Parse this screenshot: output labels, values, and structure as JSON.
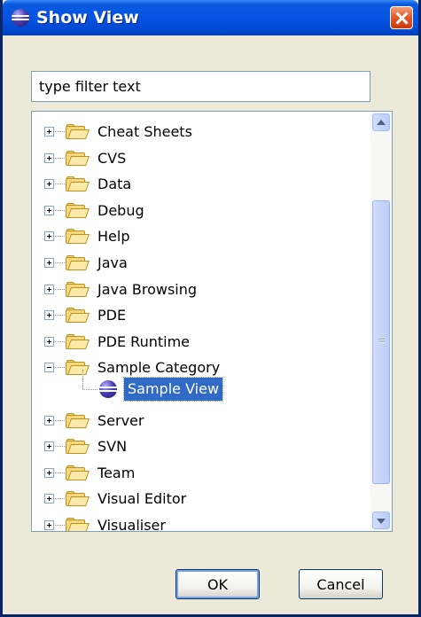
{
  "window": {
    "title": "Show View",
    "title_icon": "eclipse-icon",
    "close_icon": "close-icon"
  },
  "filter": {
    "value": "type filter text"
  },
  "tree": {
    "items": [
      {
        "label": "Cheat Sheets",
        "expanded": false
      },
      {
        "label": "CVS",
        "expanded": false
      },
      {
        "label": "Data",
        "expanded": false
      },
      {
        "label": "Debug",
        "expanded": false
      },
      {
        "label": "Help",
        "expanded": false
      },
      {
        "label": "Java",
        "expanded": false
      },
      {
        "label": "Java Browsing",
        "expanded": false
      },
      {
        "label": "PDE",
        "expanded": false
      },
      {
        "label": "PDE Runtime",
        "expanded": false
      },
      {
        "label": "Sample Category",
        "expanded": true
      },
      {
        "label": "Server",
        "expanded": false
      },
      {
        "label": "SVN",
        "expanded": false
      },
      {
        "label": "Team",
        "expanded": false
      },
      {
        "label": "Visual Editor",
        "expanded": false
      },
      {
        "label": "Visualiser",
        "expanded": false
      }
    ],
    "selected_child": {
      "label": "Sample View",
      "parent": "Sample Category"
    }
  },
  "buttons": {
    "ok": "OK",
    "cancel": "Cancel"
  },
  "colors": {
    "titlebar": "#0554e3",
    "selection": "#316ac5",
    "dialog_bg": "#ece9d8"
  }
}
